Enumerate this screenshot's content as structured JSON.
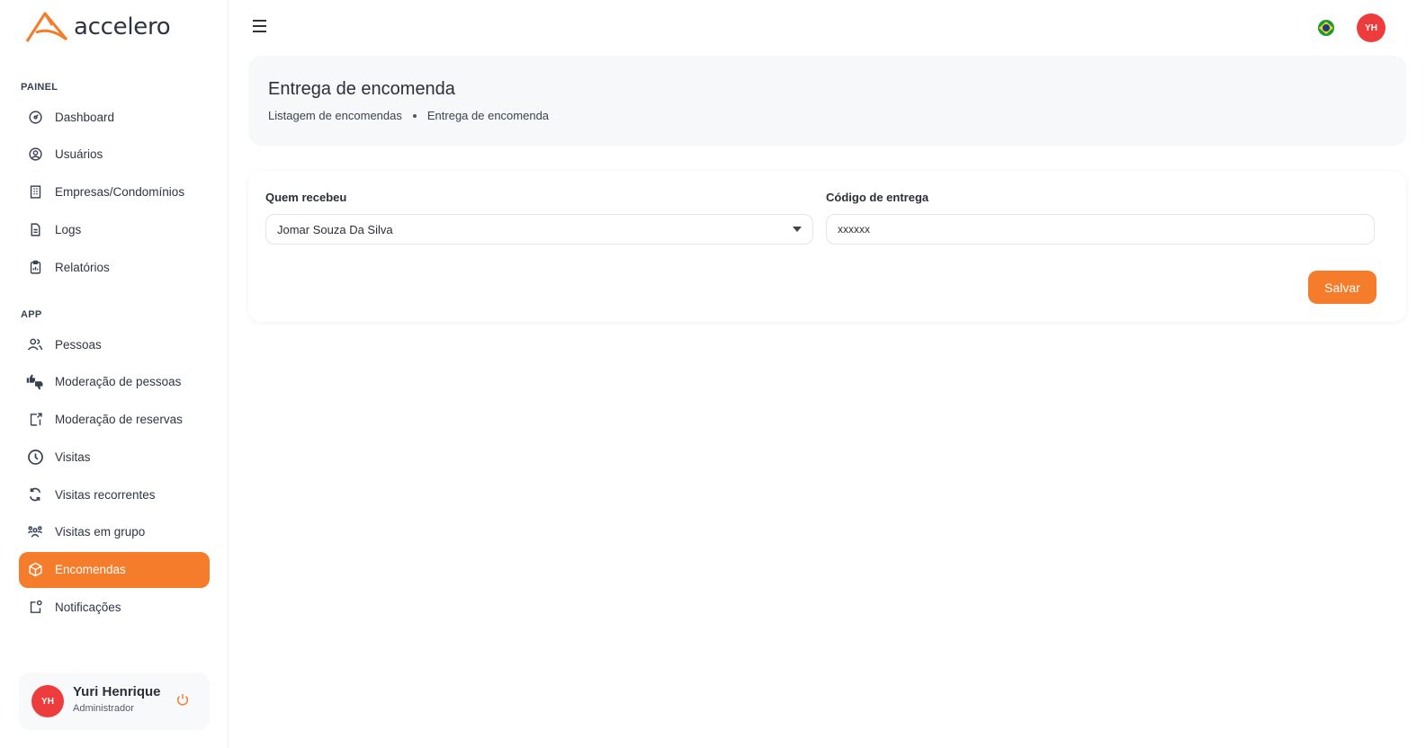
{
  "brand": {
    "name": "accelero",
    "accent": "#f47c2a",
    "avatar_color": "#ee3b3b"
  },
  "sidebar": {
    "painel_title": "PAINEL",
    "painel_items": [
      {
        "label": "Dashboard",
        "icon": "dashboard-icon"
      },
      {
        "label": "Usuários",
        "icon": "user-circle-icon"
      },
      {
        "label": "Empresas/Condomínios",
        "icon": "building-icon"
      },
      {
        "label": "Logs",
        "icon": "document-icon"
      },
      {
        "label": "Relatórios",
        "icon": "clipboard-icon"
      }
    ],
    "app_title": "APP",
    "app_items": [
      {
        "label": "Pessoas",
        "icon": "people-icon"
      },
      {
        "label": "Moderação de pessoas",
        "icon": "thumbs-icon"
      },
      {
        "label": "Moderação de reservas",
        "icon": "door-icon"
      },
      {
        "label": "Visitas",
        "icon": "clock-icon"
      },
      {
        "label": "Visitas recorrentes",
        "icon": "refresh-icon"
      },
      {
        "label": "Visitas em grupo",
        "icon": "group-icon"
      },
      {
        "label": "Encomendas",
        "icon": "package-icon",
        "active": true
      },
      {
        "label": "Notificações",
        "icon": "notification-icon"
      }
    ]
  },
  "user": {
    "initials": "YH",
    "name": "Yuri Henrique",
    "role": "Administrador"
  },
  "topbar": {
    "initials": "YH"
  },
  "page": {
    "title": "Entrega de encomenda",
    "breadcrumb": [
      "Listagem de encomendas",
      "Entrega de encomenda"
    ]
  },
  "form": {
    "receiver_label": "Quem recebeu",
    "receiver_value": "Jomar Souza Da Silva",
    "code_label": "Código de entrega",
    "code_value": "xxxxxx",
    "save_label": "Salvar"
  }
}
